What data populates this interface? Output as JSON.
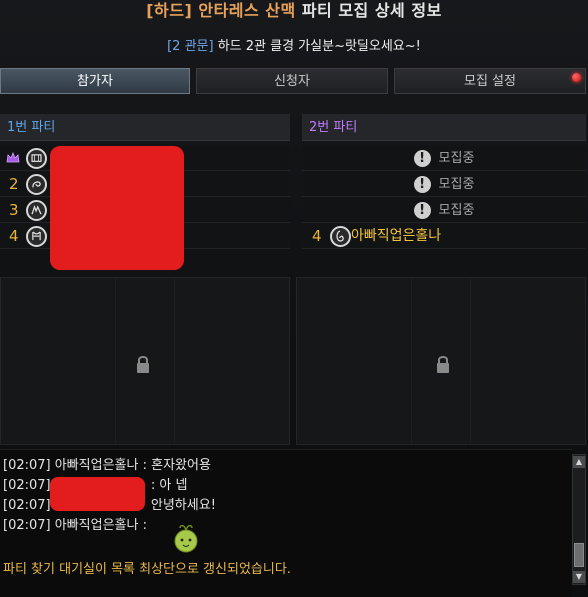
{
  "window": {
    "title_prefix": "[하드]",
    "title_location": "안타레스 산맥",
    "title_rest": "파티 모집 상세 정보",
    "subtitle_category": "[2 관문]",
    "subtitle_text": "하드 2관 클경 가실분~랏딜오세요~!"
  },
  "tabs": [
    {
      "label": "참가자",
      "active": true
    },
    {
      "label": "신청자",
      "active": false
    },
    {
      "label": "모집 설정",
      "active": false
    }
  ],
  "party1": {
    "header": "1번 파티",
    "slots": [
      {
        "number": "",
        "leader": true,
        "class_icon": "class-icon-1"
      },
      {
        "number": "2",
        "class_icon": "class-icon-2"
      },
      {
        "number": "3",
        "class_icon": "class-icon-3"
      },
      {
        "number": "4",
        "class_icon": "class-icon-4"
      }
    ]
  },
  "party2": {
    "header": "2번 파티",
    "slots": [
      {
        "status": "모집중"
      },
      {
        "status": "모집중"
      },
      {
        "status": "모집중"
      },
      {
        "number": "4",
        "name": "아빠직업은홀나",
        "class_icon": "class-icon-holyknight"
      }
    ]
  },
  "chat": {
    "lines": [
      {
        "time": "[02:07]",
        "text": "아빠직업은홀나 : 혼자왔어용"
      },
      {
        "time": "[02:07]",
        "text": ": 아 넵"
      },
      {
        "time": "[02:07]",
        "text": "안녕하세요!"
      },
      {
        "time": "[02:07]",
        "text": "아빠직업은홀나 :"
      }
    ],
    "system_message": "파티 찾기 대기실이 목록 최상단으로 갱신되었습니다."
  },
  "colors": {
    "accent_tab": "#4a5763",
    "party1_header": "#5fa5ea",
    "party2_header": "#c27bff",
    "gold": "#e8b53c",
    "system_text": "#e9b84a",
    "redaction": "#e31d1d"
  }
}
